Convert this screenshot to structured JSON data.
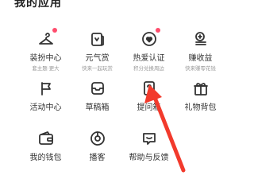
{
  "section": {
    "title": "我的应用"
  },
  "rows": [
    [
      {
        "label": "装扮中心",
        "sub": "套主题·更大",
        "icon": "hanger-icon",
        "badge": true
      },
      {
        "label": "元气赏",
        "sub": "快来一起玩赏",
        "icon": "gift-card-icon",
        "badge": false
      },
      {
        "label": "热爱认证",
        "sub": "积分兑换周边",
        "icon": "heart-badge-icon",
        "badge": true
      },
      {
        "label": "赚收益",
        "sub": "快来赚零花钱",
        "icon": "coins-icon",
        "badge": false
      }
    ],
    [
      {
        "label": "活动中心",
        "sub": "",
        "icon": "flag-icon",
        "badge": false
      },
      {
        "label": "草稿箱",
        "sub": "",
        "icon": "inbox-icon",
        "badge": false
      },
      {
        "label": "提问箱",
        "sub": "",
        "icon": "question-box-icon",
        "badge": false
      },
      {
        "label": "礼物背包",
        "sub": "",
        "icon": "gift-icon",
        "badge": false
      }
    ],
    [
      {
        "label": "我的钱包",
        "sub": "",
        "icon": "wallet-icon",
        "badge": false
      },
      {
        "label": "播客",
        "sub": "",
        "icon": "podcast-icon",
        "badge": false
      },
      {
        "label": "帮助与反馈",
        "sub": "",
        "icon": "help-chat-icon",
        "badge": false
      }
    ]
  ],
  "colors": {
    "badge": "#ff4d6d",
    "arrow": "#f23a2c",
    "icon_stroke": "#333333"
  }
}
